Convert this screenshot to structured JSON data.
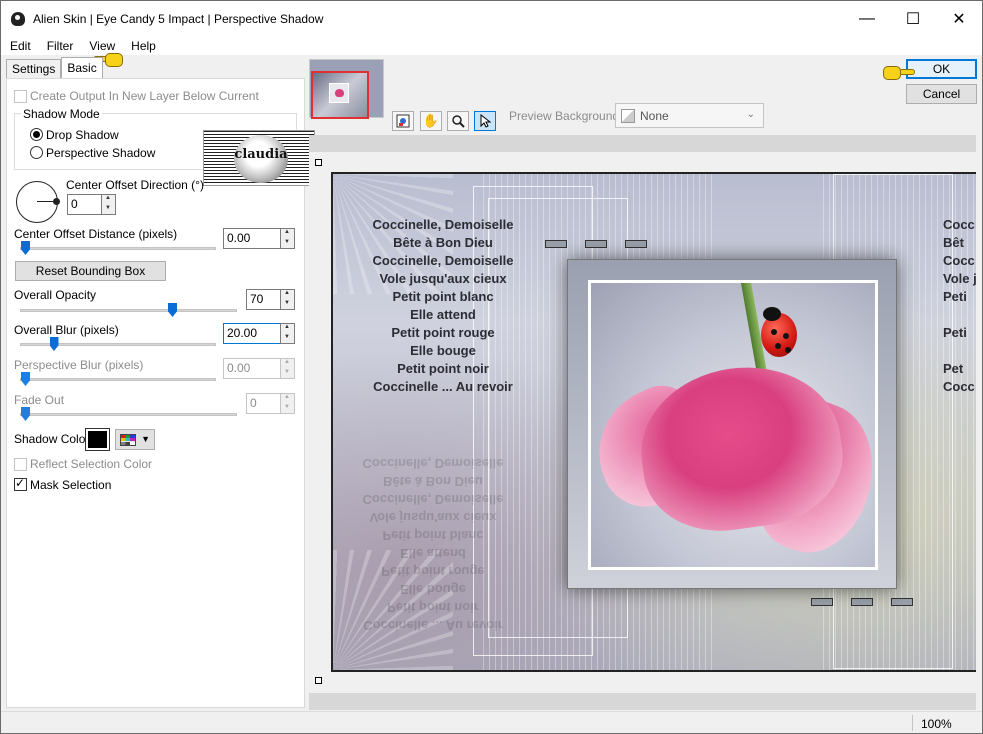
{
  "window": {
    "title": "Alien Skin | Eye Candy 5 Impact | Perspective Shadow",
    "minimize": "—",
    "maximize": "☐",
    "close": "✕"
  },
  "menu": [
    "Edit",
    "Filter",
    "View",
    "Help"
  ],
  "tabs": [
    "Settings",
    "Basic"
  ],
  "options": {
    "create_output": "Create Output In New Layer Below Current",
    "shadow_mode_title": "Shadow Mode",
    "drop_shadow": "Drop Shadow",
    "perspective_shadow": "Perspective Shadow",
    "center_offset_direction": "Center Offset Direction (°)",
    "center_offset_direction_value": "0",
    "center_offset_distance": "Center Offset Distance (pixels)",
    "center_offset_distance_value": "0.00",
    "reset_bounding_box": "Reset Bounding Box",
    "overall_opacity": "Overall Opacity",
    "overall_opacity_value": "70",
    "overall_blur": "Overall Blur (pixels)",
    "overall_blur_value": "20.00",
    "perspective_blur": "Perspective Blur (pixels)",
    "perspective_blur_value": "0.00",
    "fade_out": "Fade Out",
    "fade_out_value": "0",
    "shadow_color": "Shadow Color",
    "reflect_selection_color": "Reflect Selection Color",
    "mask_selection": "Mask Selection"
  },
  "sliders": {
    "center_offset_distance": 0,
    "overall_opacity": 0.7,
    "overall_blur": 0.15,
    "perspective_blur": 0,
    "fade_out": 0
  },
  "watermark_text": "claudia",
  "buttons": {
    "ok": "OK",
    "cancel": "Cancel"
  },
  "preview": {
    "background_label": "Preview Background:",
    "background_value": "None",
    "poem_lines": [
      "Coccinelle, Demoiselle",
      "Bête à Bon Dieu",
      "Coccinelle, Demoiselle",
      "Vole jusqu'aux cieux",
      "Petit point blanc",
      "Elle attend",
      "Petit point rouge",
      "Elle bouge",
      "Petit point noir",
      "Coccinelle ... Au revoir"
    ],
    "poem_lines_right": [
      "Cocc",
      "Bêt",
      "Cocc",
      "Vole j",
      "Peti",
      "",
      "Peti",
      "",
      "Pet",
      "Cocc"
    ]
  },
  "icons": {
    "tool_1": "zoom-fit-icon",
    "tool_2": "hand-icon",
    "tool_3": "magnifier-icon",
    "tool_4": "arrow-pointer-icon"
  },
  "status": {
    "zoom": "100%"
  },
  "colors": {
    "shadow": "#000000",
    "accent": "#0078d7"
  }
}
